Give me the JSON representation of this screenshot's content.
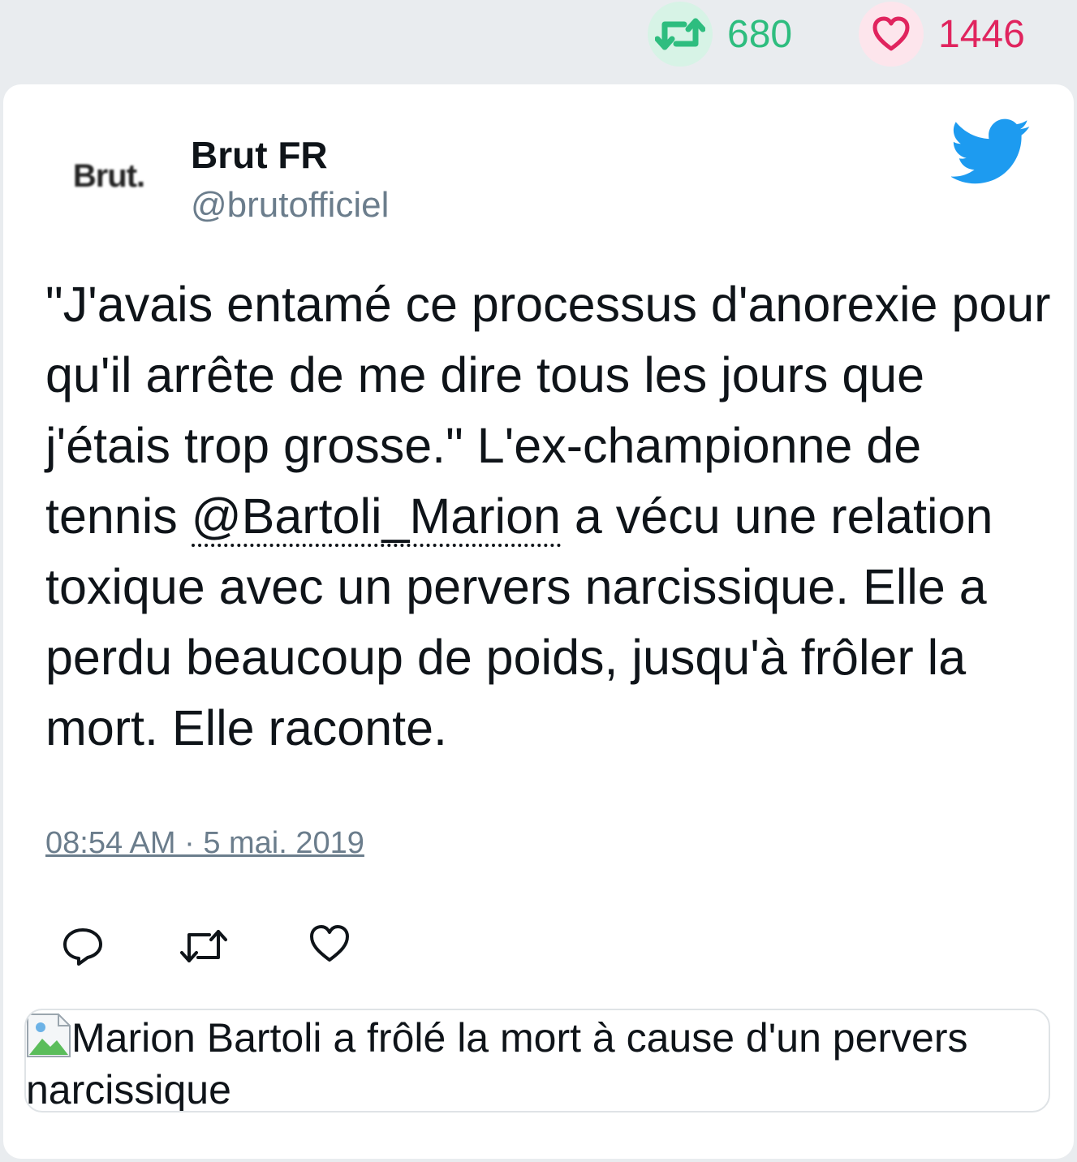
{
  "stats": {
    "retweets": "680",
    "likes": "1446"
  },
  "author": {
    "name": "Brut FR",
    "handle": "@brutofficiel",
    "avatar_text": "Brut."
  },
  "tweet": {
    "text_before": "\"J'avais entamé ce processus d'anorexie pour qu'il arrête de me dire tous les jours que j'étais trop grosse.\" L'ex-championne de tennis ",
    "mention": "@Bartoli_Marion",
    "text_after": " a vécu une relation toxique avec un pervers narcissique. Elle a perdu beaucoup de poids, jusqu'à frôler la mort. Elle raconte.",
    "date": "08:54 AM · 5 mai. 2019"
  },
  "preview": {
    "alt_text": "Marion Bartoli a frôlé la mort à cause d'un pervers narcissique"
  },
  "colors": {
    "retweet": "#2ebd7f",
    "like": "#e0245e",
    "twitter_blue": "#1d9bf0",
    "muted": "#6b7d8c"
  },
  "icons": [
    "retweet-icon",
    "heart-icon",
    "twitter-bird-icon",
    "reply-icon",
    "broken-image-icon"
  ]
}
